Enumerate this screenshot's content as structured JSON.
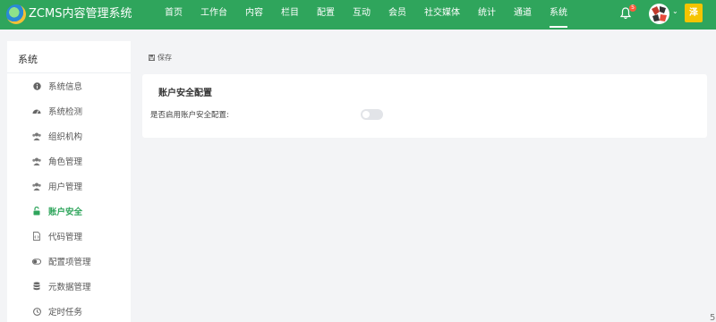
{
  "header": {
    "app_title": "ZCMS内容管理系统",
    "nav": [
      "首页",
      "工作台",
      "内容",
      "栏目",
      "配置",
      "互动",
      "会员",
      "社交媒体",
      "统计",
      "通道",
      "系统"
    ],
    "active_nav": "系统",
    "notification_count": "5",
    "user_initial": "泽",
    "brand_color": "#2fa55c"
  },
  "sidebar": {
    "title": "系统",
    "items": [
      {
        "label": "系统信息",
        "icon": "info-icon"
      },
      {
        "label": "系统检测",
        "icon": "dashboard-icon"
      },
      {
        "label": "组织机构",
        "icon": "users-icon"
      },
      {
        "label": "角色管理",
        "icon": "users-icon"
      },
      {
        "label": "用户管理",
        "icon": "users-icon"
      },
      {
        "label": "账户安全",
        "icon": "unlock-icon"
      },
      {
        "label": "代码管理",
        "icon": "file-code-icon"
      },
      {
        "label": "配置项管理",
        "icon": "toggle-icon"
      },
      {
        "label": "元数据管理",
        "icon": "database-icon"
      },
      {
        "label": "定时任务",
        "icon": "clock-icon"
      }
    ],
    "active": "账户安全"
  },
  "toolbar": {
    "save_label": "保存",
    "save_icon": "save-icon"
  },
  "card": {
    "title": "账户安全配置",
    "field_label": "是否启用账户安全配置:",
    "toggle_on": false
  },
  "corner_mark": "5"
}
